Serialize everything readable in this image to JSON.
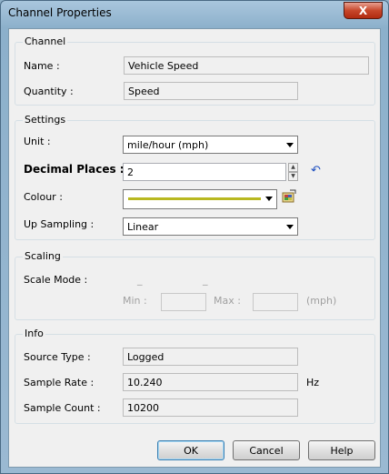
{
  "window": {
    "title": "Channel Properties",
    "close_label": "X"
  },
  "channel": {
    "group_title": "Channel",
    "name_label": "Name :",
    "name_value": "Vehicle Speed",
    "quantity_label": "Quantity :",
    "quantity_value": "Speed"
  },
  "settings": {
    "group_title": "Settings",
    "unit_label": "Unit :",
    "unit_value": "mile/hour (mph)",
    "decimal_label": "Decimal Places :",
    "decimal_value": "2",
    "colour_label": "Colour :",
    "colour_value": "#b8b820",
    "upsampling_label": "Up Sampling :",
    "upsampling_value": "Linear"
  },
  "scaling": {
    "group_title": "Scaling",
    "mode_label": "Scale Mode :",
    "min_label": "Min :",
    "max_label": "Max :",
    "unit_label": "(mph)"
  },
  "info": {
    "group_title": "Info",
    "source_type_label": "Source Type :",
    "source_type_value": "Logged",
    "sample_rate_label": "Sample Rate :",
    "sample_rate_value": "10.240",
    "sample_rate_unit": "Hz",
    "sample_count_label": "Sample Count :",
    "sample_count_value": "10200"
  },
  "buttons": {
    "ok": "OK",
    "cancel": "Cancel",
    "help": "Help"
  }
}
